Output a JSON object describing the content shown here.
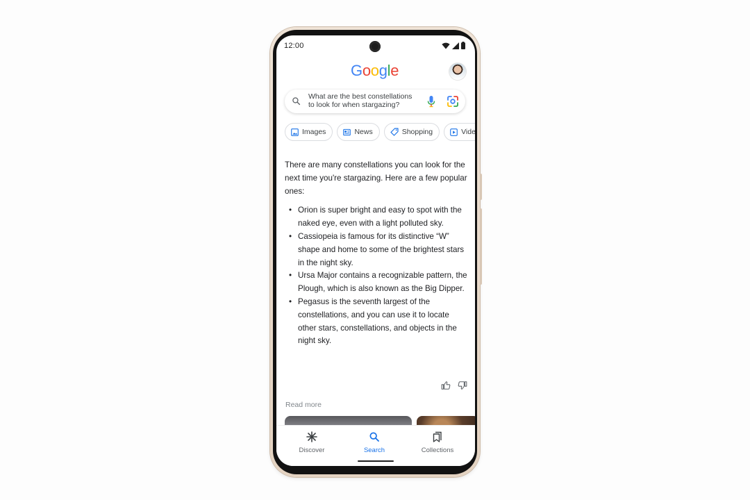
{
  "status_bar": {
    "time": "12:00",
    "icons": [
      "wifi-icon",
      "cellular-signal-icon",
      "battery-icon"
    ]
  },
  "header": {
    "logo": [
      "G",
      "o",
      "o",
      "g",
      "l",
      "e"
    ],
    "logo_colors": [
      "#4285F4",
      "#EA4335",
      "#FBBC05",
      "#4285F4",
      "#34A853",
      "#EA4335"
    ],
    "avatar_icon": "user-avatar"
  },
  "search": {
    "query_line1": "What are the best constellations",
    "query_line2": "to look for when stargazing?",
    "icons": [
      "search-icon",
      "mic-icon",
      "lens-icon"
    ]
  },
  "chips": [
    {
      "label": "Images",
      "icon": "image-icon"
    },
    {
      "label": "News",
      "icon": "news-icon"
    },
    {
      "label": "Shopping",
      "icon": "tag-icon"
    },
    {
      "label": "Vide",
      "icon": "play-icon"
    }
  ],
  "answer": {
    "intro": "There are many constellations you can look for the next time you're stargazing. Here are a few popular ones:",
    "bullets": [
      "Orion is super bright and easy to spot with the naked eye, even with a light polluted sky.",
      "Cassiopeia is famous for its distinctive “W” shape and home to some of the brightest stars in the night sky.",
      "Ursa Major contains a recognizable pattern, the Plough, which is also known as the Big Dipper.",
      "Pegasus is the seventh largest of the constellations, and you can use it to locate other stars, constellations, and objects in the night sky."
    ]
  },
  "feedback": {
    "icons": [
      "thumbs-up-icon",
      "thumbs-down-icon"
    ]
  },
  "read_more": "Read more",
  "bottom_nav": {
    "items": [
      {
        "label": "Discover",
        "icon": "asterisk-icon",
        "active": false
      },
      {
        "label": "Search",
        "icon": "search-icon",
        "active": true
      },
      {
        "label": "Collections",
        "icon": "bookmark-collections-icon",
        "active": false
      }
    ],
    "active_color": "#1a73e8",
    "inactive_color": "#5f6368"
  }
}
